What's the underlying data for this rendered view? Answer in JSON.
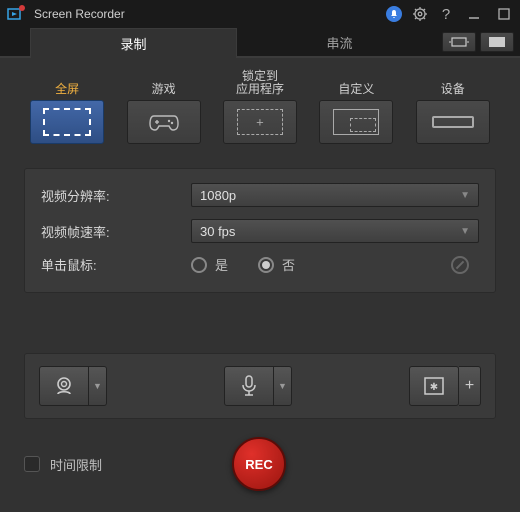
{
  "titlebar": {
    "title": "Screen Recorder"
  },
  "tabs": {
    "record": "录制",
    "stream": "串流"
  },
  "modes": {
    "fullscreen": "全屏",
    "game": "游戏",
    "lock": "锁定到\n应用程序",
    "custom": "自定义",
    "device": "设备"
  },
  "settings": {
    "resolution_label": "视频分辨率:",
    "resolution_value": "1080p",
    "framerate_label": "视频帧速率:",
    "framerate_value": "30 fps",
    "click_label": "单击鼠标:",
    "yes": "是",
    "no": "否"
  },
  "footer": {
    "time_limit": "时间限制",
    "rec": "REC"
  },
  "plus": "+",
  "chev": "▼"
}
